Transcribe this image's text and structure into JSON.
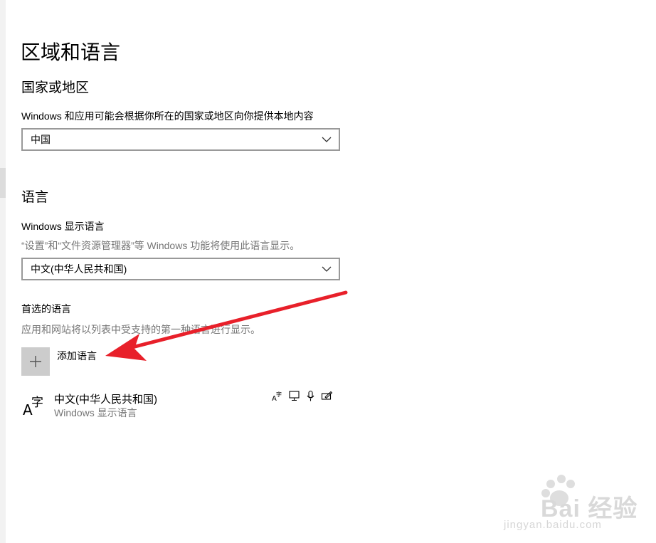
{
  "page": {
    "title": "区域和语言"
  },
  "region": {
    "heading": "国家或地区",
    "description": "Windows 和应用可能会根据你所在的国家或地区向你提供本地内容",
    "selected": "中国"
  },
  "language": {
    "heading": "语言",
    "display_label": "Windows 显示语言",
    "display_hint": "“设置”和“文件资源管理器”等 Windows 功能将使用此语言显示。",
    "display_selected": "中文(中华人民共和国)",
    "preferred_label": "首选的语言",
    "preferred_hint": "应用和网站将以列表中受支持的第一种语言进行显示。",
    "add_label": "添加语言",
    "items": [
      {
        "name": "中文(中华人民共和国)",
        "sub": "Windows 显示语言",
        "icon": "language-font-icon",
        "features": [
          "language-pack-icon",
          "display-icon",
          "speech-icon",
          "handwriting-icon"
        ]
      }
    ]
  },
  "annotation": {
    "arrow_color": "#e8202a"
  },
  "watermark": {
    "brand": "Bai  经验",
    "url": "jingyan.baidu.com"
  }
}
